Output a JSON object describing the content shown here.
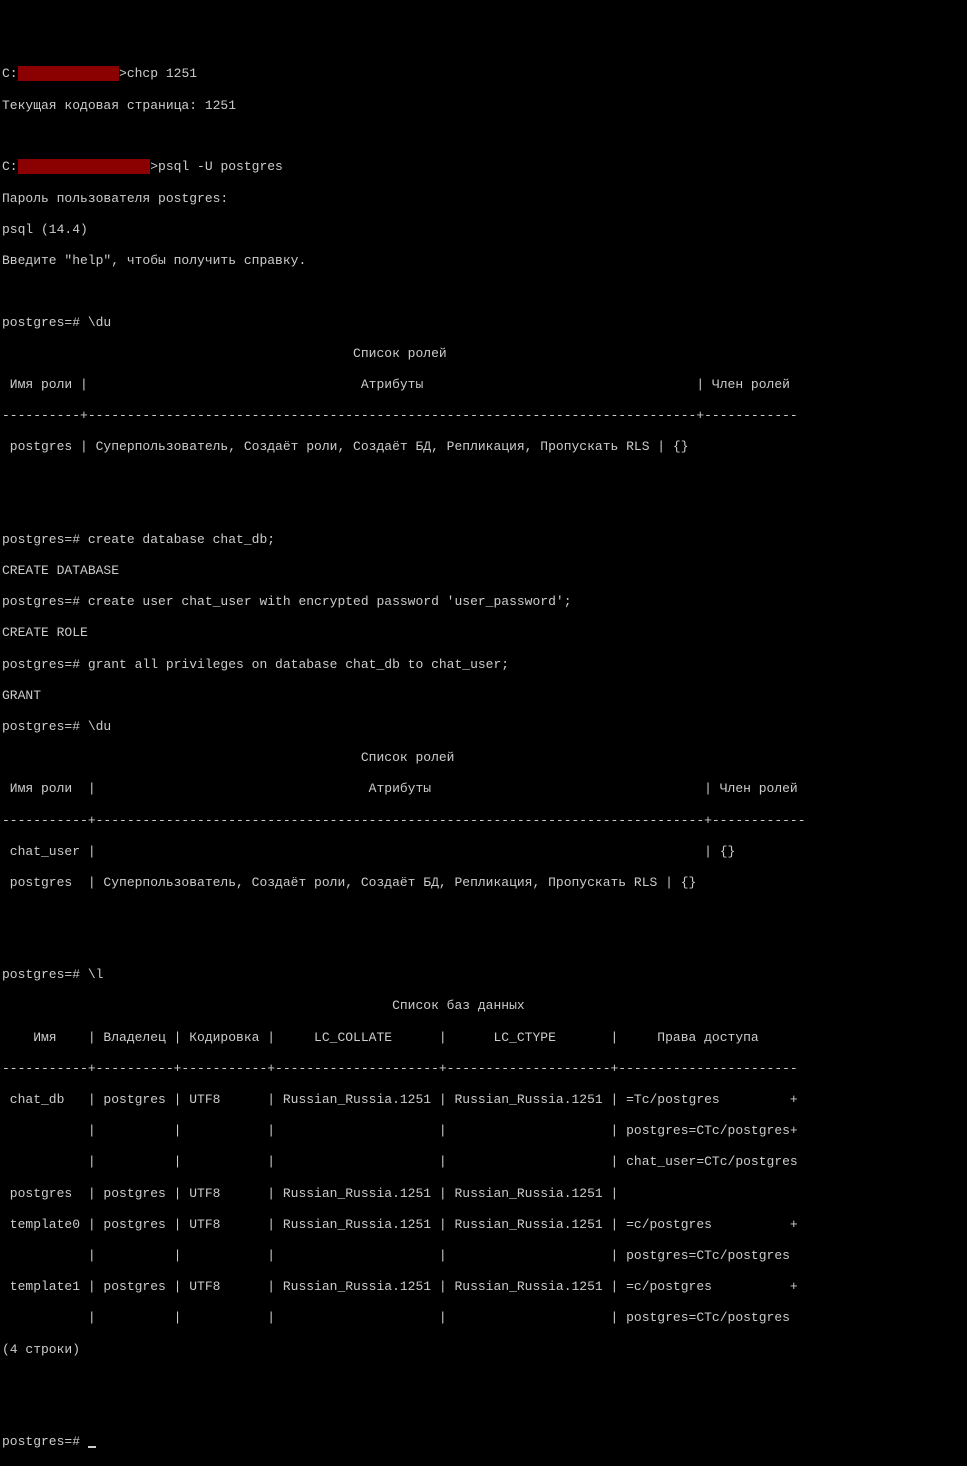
{
  "lines": {
    "l01a": "C:",
    "l01b": "             ",
    "l01c": ">chcp 1251",
    "l02": "Текущая кодовая страница: 1251",
    "l03": "",
    "l04a": "C:",
    "l04b": "                 ",
    "l04c": ">psql -U postgres",
    "l05": "Пароль пользователя postgres:",
    "l06": "psql (14.4)",
    "l07": "Введите \"help\", чтобы получить справку.",
    "l08": "",
    "l09": "postgres=# \\du",
    "l10": "                                             Список ролей",
    "l11": " Имя роли |                                   Атрибуты                                   | Член ролей",
    "l12": "----------+------------------------------------------------------------------------------+------------",
    "l13": " postgres | Суперпользователь, Создаёт роли, Создаёт БД, Репликация, Пропускать RLS | {}",
    "l14": "",
    "l15": "",
    "l16": "postgres=# create database chat_db;",
    "l17": "CREATE DATABASE",
    "l18": "postgres=# create user chat_user with encrypted password 'user_password';",
    "l19": "CREATE ROLE",
    "l20": "postgres=# grant all privileges on database chat_db to chat_user;",
    "l21": "GRANT",
    "l22": "postgres=# \\du",
    "l23": "                                              Список ролей",
    "l24": " Имя роли  |                                   Атрибуты                                   | Член ролей",
    "l25": "-----------+------------------------------------------------------------------------------+------------",
    "l26": " chat_user |                                                                              | {}",
    "l27": " postgres  | Суперпользователь, Создаёт роли, Создаёт БД, Репликация, Пропускать RLS | {}",
    "l28": "",
    "l29": "",
    "l30": "postgres=# \\l",
    "l31": "                                                  Список баз данных",
    "l32": "    Имя    | Владелец | Кодировка |     LC_COLLATE      |      LC_CTYPE       |     Права доступа",
    "l33": "-----------+----------+-----------+---------------------+---------------------+-----------------------",
    "l34": " chat_db   | postgres | UTF8      | Russian_Russia.1251 | Russian_Russia.1251 | =Tc/postgres         +",
    "l35": "           |          |           |                     |                     | postgres=CTc/postgres+",
    "l36": "           |          |           |                     |                     | chat_user=CTc/postgres",
    "l37": " postgres  | postgres | UTF8      | Russian_Russia.1251 | Russian_Russia.1251 |",
    "l38": " template0 | postgres | UTF8      | Russian_Russia.1251 | Russian_Russia.1251 | =c/postgres          +",
    "l39": "           |          |           |                     |                     | postgres=CTc/postgres",
    "l40": " template1 | postgres | UTF8      | Russian_Russia.1251 | Russian_Russia.1251 | =c/postgres          +",
    "l41": "           |          |           |                     |                     | postgres=CTc/postgres",
    "l42": "(4 строки)",
    "l43": "",
    "l44": "",
    "l45": "postgres=# "
  }
}
